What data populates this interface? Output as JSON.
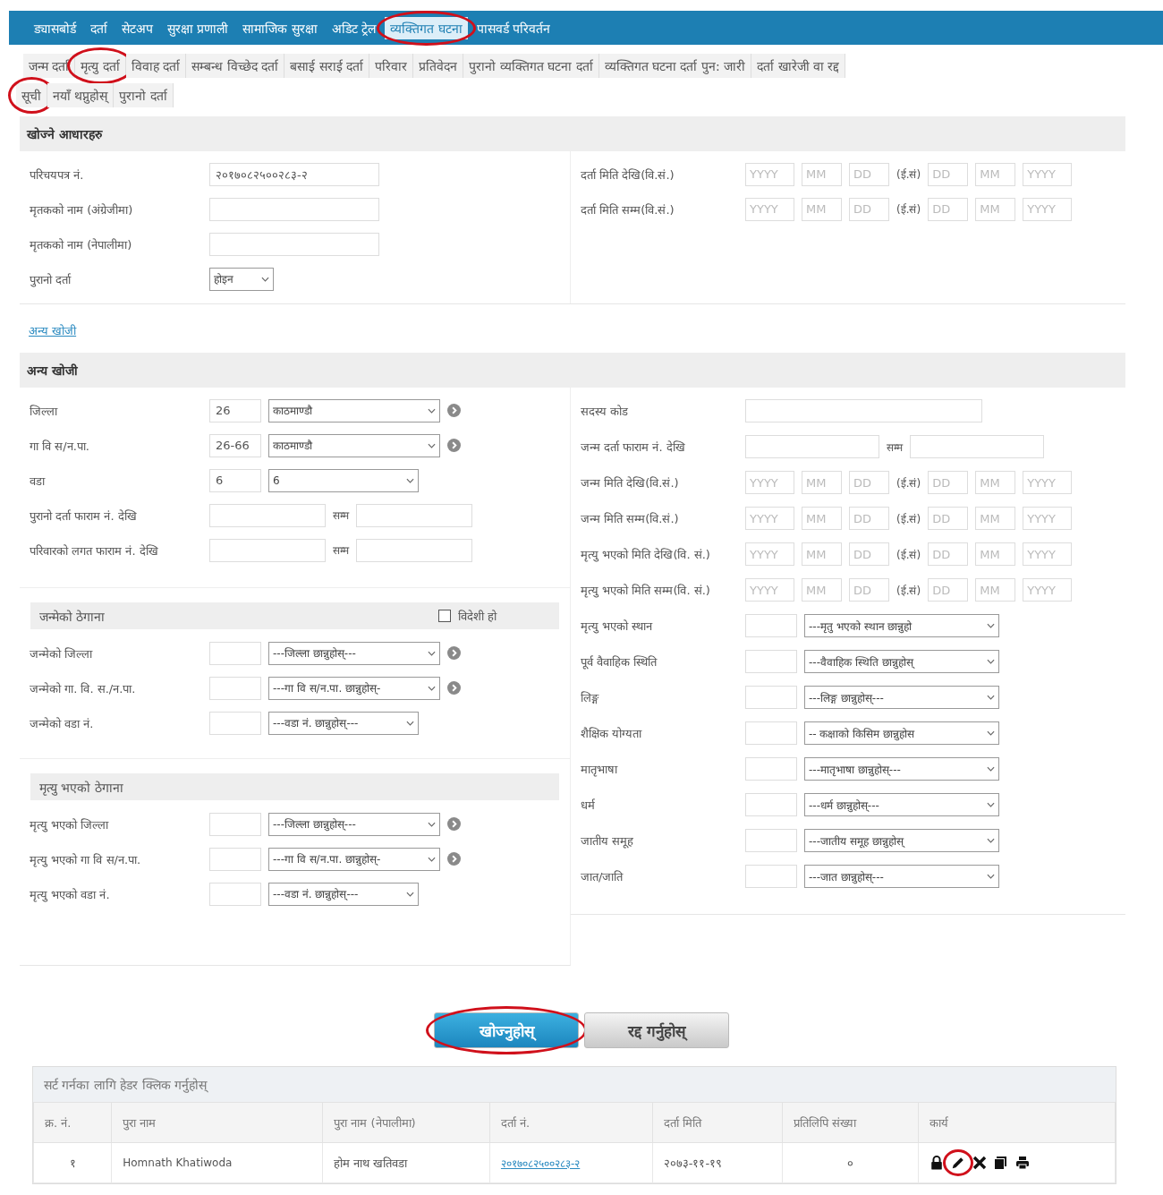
{
  "nav": [
    {
      "label": "ड्यासबोर्ड",
      "selected": false,
      "circled": false
    },
    {
      "label": "दर्ता",
      "selected": false,
      "circled": false
    },
    {
      "label": "सेटअप",
      "selected": false,
      "circled": false
    },
    {
      "label": "सुरक्षा प्रणाली",
      "selected": false,
      "circled": false
    },
    {
      "label": "सामाजिक सुरक्षा",
      "selected": false,
      "circled": false
    },
    {
      "label": "अडिट ट्रेल",
      "selected": false,
      "circled": false
    },
    {
      "label": "व्यक्तिगत घटना",
      "selected": true,
      "circled": true
    },
    {
      "label": "पासवर्ड परिवर्तन",
      "selected": false,
      "circled": false
    }
  ],
  "subtab_rows": [
    [
      {
        "label": "जन्म दर्ता",
        "circled": false
      },
      {
        "label": "मृत्यु दर्ता",
        "circled": true
      },
      {
        "label": "विवाह दर्ता",
        "circled": false
      },
      {
        "label": "सम्बन्ध विच्छेद दर्ता",
        "circled": false
      },
      {
        "label": "बसाई सराई दर्ता",
        "circled": false
      },
      {
        "label": "परिवार",
        "circled": false
      },
      {
        "label": "प्रतिवेदन",
        "circled": false
      },
      {
        "label": "पुरानो व्यक्तिगत घटना दर्ता",
        "circled": false
      },
      {
        "label": "व्यक्तिगत घटना दर्ता पुन: जारी",
        "circled": false
      },
      {
        "label": "दर्ता खारेजी वा रद्द",
        "circled": false
      }
    ],
    [
      {
        "label": "सूची",
        "circled": true
      },
      {
        "label": "नयाँ थप्नुहोस्",
        "circled": false
      },
      {
        "label": "पुरानो दर्ता",
        "circled": false
      }
    ]
  ],
  "search_criteria": {
    "title": "खोज्ने आधारहरु",
    "left": [
      {
        "kind": "text",
        "label": "परिचयपत्र नं.",
        "value": "२०१७०८२५००२८३-२"
      },
      {
        "kind": "text",
        "label": "मृतकको नाम (अंग्रेजीमा)"
      },
      {
        "kind": "text",
        "label": "मृतकको नाम (नेपालीमा)"
      },
      {
        "kind": "select",
        "label": "पुरानो दर्ता",
        "value": "होइन"
      }
    ],
    "right": [
      {
        "kind": "date",
        "label": "दर्ता मिति देखि(वि.सं.)",
        "bs": [
          {
            "placeholder": "YYYY"
          },
          {
            "placeholder": "MM"
          },
          {
            "placeholder": "DD"
          }
        ],
        "era": "(ई.सं)",
        "ad": [
          {
            "placeholder": "DD"
          },
          {
            "placeholder": "MM"
          },
          {
            "placeholder": "YYYY"
          }
        ]
      },
      {
        "kind": "date",
        "label": "दर्ता मिति सम्म(वि.सं.)",
        "bs": [
          {
            "placeholder": "YYYY"
          },
          {
            "placeholder": "MM"
          },
          {
            "placeholder": "DD"
          }
        ],
        "era": "(ई.सं)",
        "ad": [
          {
            "placeholder": "DD"
          },
          {
            "placeholder": "MM"
          },
          {
            "placeholder": "YYYY"
          }
        ]
      }
    ]
  },
  "other_link": "अन्य खोजी",
  "other_search": {
    "title": "अन्य खोजी",
    "left": [
      {
        "kind": "code_select",
        "label": "जिल्ला",
        "code": "26",
        "value": "काठमाण्डौ",
        "info": true
      },
      {
        "kind": "code_select",
        "label": "गा वि स/न.पा.",
        "code": "26-66",
        "value": "काठमाण्डौ",
        "info": true
      },
      {
        "kind": "code_select",
        "label": "वडा",
        "code": "6",
        "value": "6",
        "info": false
      },
      {
        "kind": "range",
        "label": "पुरानो दर्ता फाराम नं. देखि",
        "to": "सम्म"
      },
      {
        "kind": "range",
        "label": "परिवारको लगत फाराम नं. देखि",
        "to": "सम्म"
      }
    ],
    "sections": [
      {
        "title": "जन्मेको ठेगाना",
        "checkbox": {
          "label": "विदेशी हो",
          "checked": false
        },
        "rows": [
          {
            "kind": "code_select",
            "label": "जन्मेको जिल्ला",
            "value": "---जिल्ला छान्नुहोस्---",
            "info": true
          },
          {
            "kind": "code_select",
            "label": "जन्मेको गा. वि. स./न.पा.",
            "value": "---गा वि स/न.पा. छान्नुहोस्-",
            "info": true
          },
          {
            "kind": "code_select",
            "label": "जन्मेको वडा नं.",
            "value": "---वडा नं. छान्नुहोस्---",
            "info": false
          }
        ]
      },
      {
        "title": "मृत्यु भएको ठेगाना",
        "rows": [
          {
            "kind": "code_select",
            "label": "मृत्यु भएको जिल्ला",
            "value": "---जिल्ला छान्नुहोस्---",
            "info": true
          },
          {
            "kind": "code_select",
            "label": "मृत्यु भएको गा वि स/न.पा.",
            "value": "---गा वि स/न.पा. छान्नुहोस्-",
            "info": true
          },
          {
            "kind": "code_select",
            "label": "मृत्यु भएको वडा नं.",
            "value": "---वडा नं. छान्नुहोस्---",
            "info": false
          }
        ]
      }
    ],
    "right": [
      {
        "kind": "text",
        "label": "सदस्य कोड"
      },
      {
        "kind": "range",
        "label": "जन्म दर्ता फाराम नं. देखि",
        "to": "सम्म"
      },
      {
        "kind": "date",
        "label": "जन्म मिति देखि(वि.सं.)",
        "bs": [
          {
            "placeholder": "YYYY"
          },
          {
            "placeholder": "MM"
          },
          {
            "placeholder": "DD"
          }
        ],
        "era": "(ई.सं)",
        "ad": [
          {
            "placeholder": "DD"
          },
          {
            "placeholder": "MM"
          },
          {
            "placeholder": "YYYY"
          }
        ]
      },
      {
        "kind": "date",
        "label": "जन्म मिति सम्म(वि.सं.)",
        "bs": [
          {
            "placeholder": "YYYY"
          },
          {
            "placeholder": "MM"
          },
          {
            "placeholder": "DD"
          }
        ],
        "era": "(ई.सं)",
        "ad": [
          {
            "placeholder": "DD"
          },
          {
            "placeholder": "MM"
          },
          {
            "placeholder": "YYYY"
          }
        ]
      },
      {
        "kind": "date",
        "label": "मृत्यु भएको मिति देखि(वि. सं.)",
        "bs": [
          {
            "placeholder": "YYYY"
          },
          {
            "placeholder": "MM"
          },
          {
            "placeholder": "DD"
          }
        ],
        "era": "(ई.सं)",
        "ad": [
          {
            "placeholder": "DD"
          },
          {
            "placeholder": "MM"
          },
          {
            "placeholder": "YYYY"
          }
        ]
      },
      {
        "kind": "date",
        "label": "मृत्यु भएको मिति सम्म(वि. सं.)",
        "bs": [
          {
            "placeholder": "YYYY"
          },
          {
            "placeholder": "MM"
          },
          {
            "placeholder": "DD"
          }
        ],
        "era": "(ई.सं)",
        "ad": [
          {
            "placeholder": "DD"
          },
          {
            "placeholder": "MM"
          },
          {
            "placeholder": "YYYY"
          }
        ]
      },
      {
        "kind": "code_select",
        "label": "मृत्यु भएको स्थान",
        "value": "---मृतु भएको स्थान छान्नुहो",
        "info": false
      },
      {
        "kind": "code_select",
        "label": "पूर्व वैवाहिक स्थिति",
        "value": "---वैवाहिक स्थिति छान्नुहोस्",
        "info": false
      },
      {
        "kind": "code_select",
        "label": "लिङ्ग",
        "value": "---लिङ्ग छान्नुहोस्---",
        "info": false
      },
      {
        "kind": "code_select",
        "label": "शैक्षिक योग्यता",
        "value": "-- कक्षाको किसिम छान्नुहोस",
        "info": false
      },
      {
        "kind": "code_select",
        "label": "मातृभाषा",
        "value": "---मातृभाषा छान्नुहोस्---",
        "info": false
      },
      {
        "kind": "code_select",
        "label": "धर्म",
        "value": "---धर्म छान्नुहोस्---",
        "info": false
      },
      {
        "kind": "code_select",
        "label": "जातीय समूह",
        "value": "---जातीय समूह छान्नुहोस्",
        "info": false
      },
      {
        "kind": "code_select",
        "label": "जात/जाति",
        "value": "---जात छान्नुहोस्---",
        "info": false
      }
    ]
  },
  "buttons": [
    {
      "label": "खोज्नुहोस्",
      "kind": "primary",
      "circled": true
    },
    {
      "label": "रद्द गर्नुहोस्",
      "kind": "secondary",
      "circled": false
    }
  ],
  "results": {
    "caption": "सर्ट गर्नका लागि हेडर क्लिक गर्नुहोस्",
    "columns": [
      "क्र. नं.",
      "पुरा नाम",
      "पुरा नाम (नेपालीमा)",
      "दर्ता नं.",
      "दर्ता मिति",
      "प्रतिलिपि संख्या",
      "कार्य"
    ],
    "rows": [
      {
        "serial": "१",
        "full_name": "Homnath Khatiwoda",
        "name_np": "होम नाथ खतिवडा",
        "reg_no": "२०१७०८२५००२८३-२",
        "reg_date": "२०७३-११-१९",
        "copies": "०",
        "actions": [
          {
            "kind": "lock",
            "circled": false
          },
          {
            "kind": "edit",
            "circled": true
          },
          {
            "kind": "delete",
            "circled": false
          },
          {
            "kind": "copy",
            "circled": false
          },
          {
            "kind": "print",
            "circled": false
          }
        ]
      }
    ]
  }
}
